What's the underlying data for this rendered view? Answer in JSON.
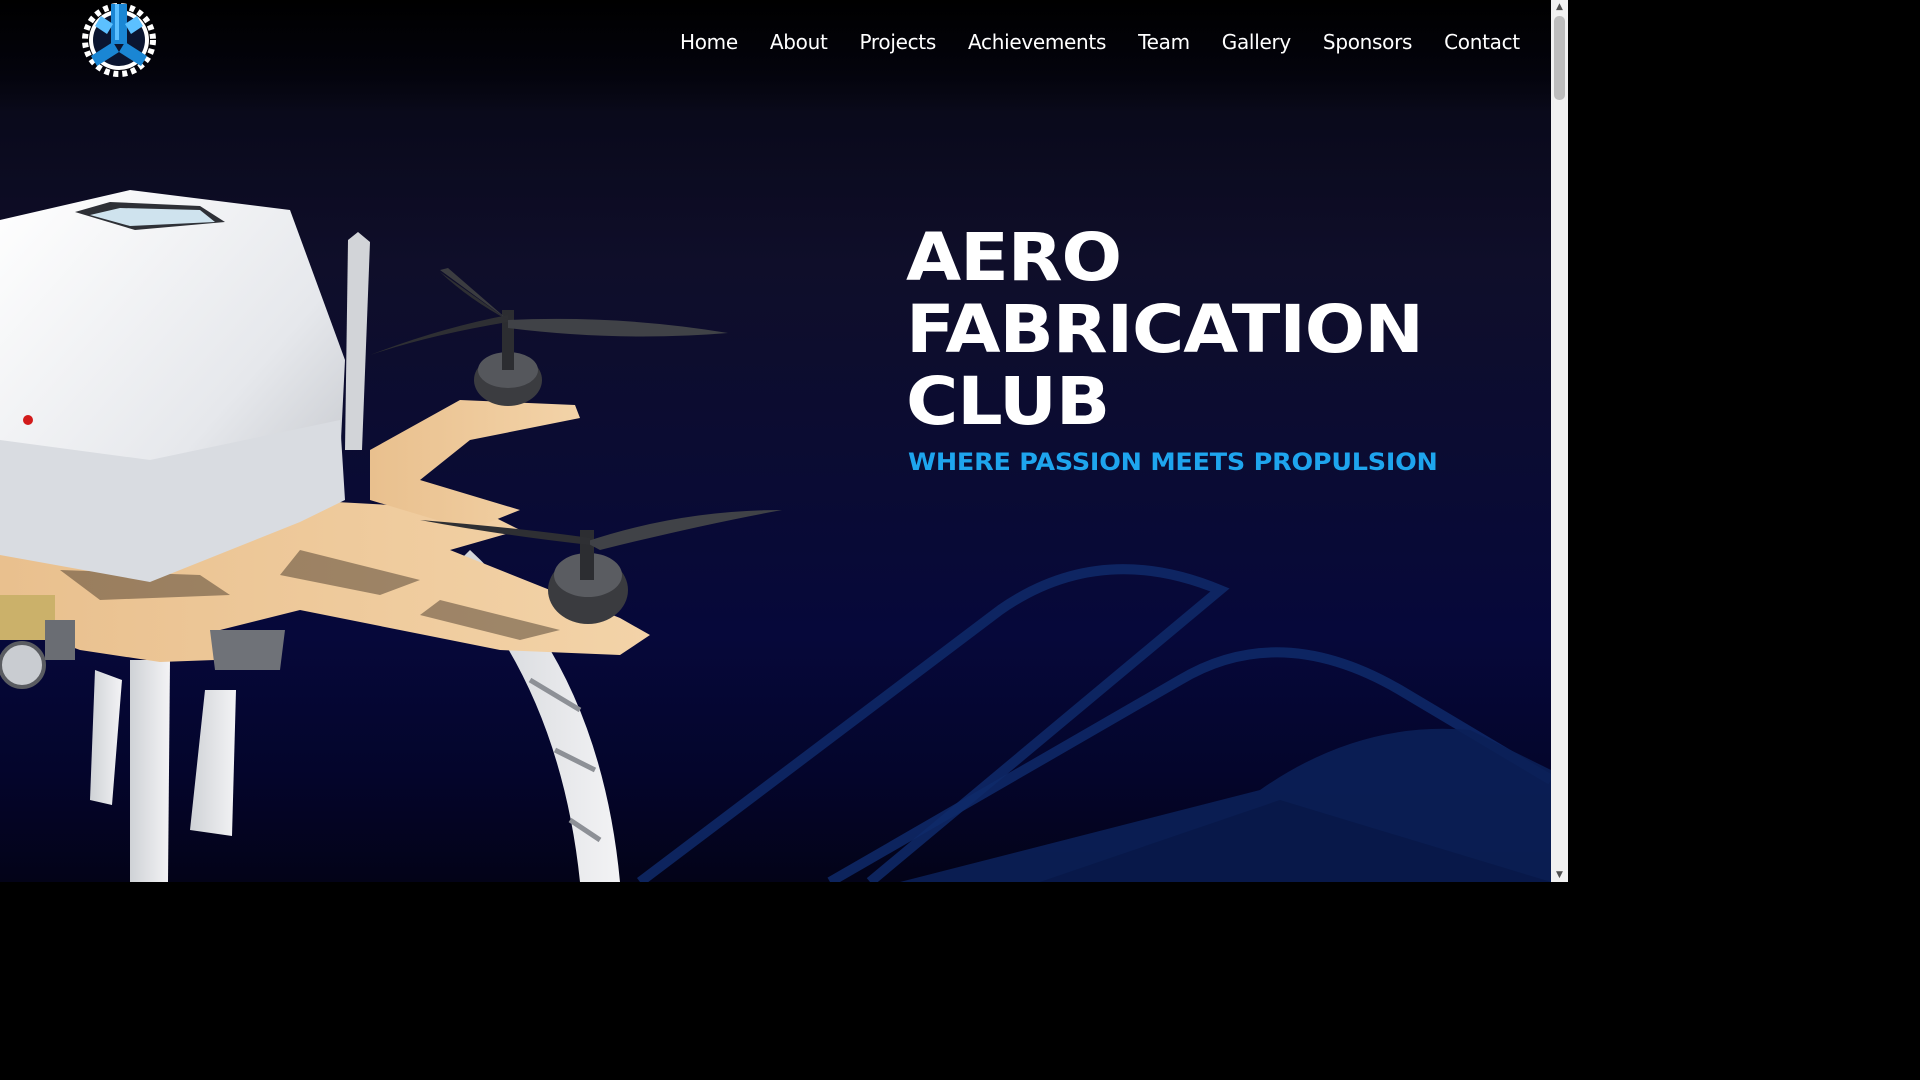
{
  "nav": {
    "items": [
      {
        "label": "Home"
      },
      {
        "label": "About"
      },
      {
        "label": "Projects"
      },
      {
        "label": "Achievements"
      },
      {
        "label": "Team"
      },
      {
        "label": "Gallery"
      },
      {
        "label": "Sponsors"
      },
      {
        "label": "Contact"
      }
    ]
  },
  "hero": {
    "title": "AERO\nFABRICATION\nCLUB",
    "tagline": "WHERE PASSION MEETS PROPULSION"
  },
  "scrollbar": {
    "up_icon": "▲",
    "down_icon": "▼"
  },
  "colors": {
    "accent": "#1ea5ee",
    "background": "#0b0c32",
    "text": "#ffffff"
  }
}
